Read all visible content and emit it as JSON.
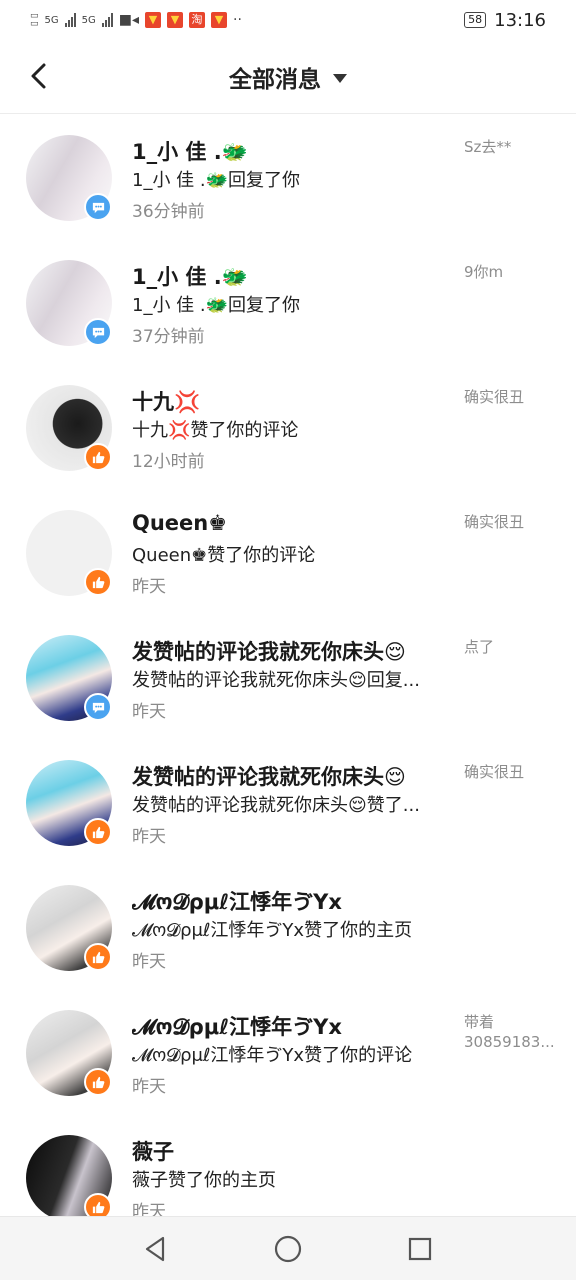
{
  "status_bar": {
    "left_icons": [
      "sim-icon",
      "signal-5g-icon",
      "signal-5g-icon",
      "video-icon",
      "notification-icon",
      "notification-icon",
      "taobao-icon",
      "notification-icon",
      "more-dots-icon"
    ],
    "net1": "5G",
    "net2": "5G",
    "taobao": "淘",
    "battery": "58",
    "time": "13:16"
  },
  "header": {
    "title": "全部消息",
    "back_icon": "back-arrow-icon",
    "dropdown_icon": "caret-down-icon"
  },
  "messages": [
    {
      "name": "1_小 佳 .🐲",
      "desc": "1_小 佳 .🐲回复了你",
      "time": "36分钟前",
      "ref": "Sz去**",
      "type": "comment"
    },
    {
      "name": "1_小 佳 .🐲",
      "desc": "1_小 佳 .🐲回复了你",
      "time": "37分钟前",
      "ref": "9你m",
      "type": "comment"
    },
    {
      "name": "十九💢",
      "desc": "十九💢赞了你的评论",
      "time": "12小时前",
      "ref": "确实很丑",
      "type": "like"
    },
    {
      "name": "Queen♚",
      "desc": "Queen♚赞了你的评论",
      "time": "昨天",
      "ref": "确实很丑",
      "type": "like"
    },
    {
      "name": "发赞帖的评论我就死你床头😌",
      "desc": "发赞帖的评论我就死你床头😌回复...",
      "time": "昨天",
      "ref": "点了",
      "type": "comment"
    },
    {
      "name": "发赞帖的评论我就死你床头😌",
      "desc": "发赞帖的评论我就死你床头😌赞了...",
      "time": "昨天",
      "ref": "确实很丑",
      "type": "like"
    },
    {
      "name": "𝓜ო𝓓ρμℓ江悸年ゔYx",
      "desc": "𝓜ო𝓓ρμℓ江悸年ゔYx赞了你的主页",
      "time": "昨天",
      "ref": "",
      "type": "like"
    },
    {
      "name": "𝓜ო𝓓ρμℓ江悸年ゔYx",
      "desc": "𝓜ო𝓓ρμℓ江悸年ゔYx赞了你的评论",
      "time": "昨天",
      "ref": "带着\n30859183...",
      "type": "like"
    },
    {
      "name": "薇子",
      "desc": "薇子赞了你的主页",
      "time": "昨天",
      "ref": "",
      "type": "like"
    }
  ],
  "colors": {
    "like_badge": "#ff7a1a",
    "comment_badge": "#4aa3f0",
    "time_text": "#8a8a8a"
  },
  "navbar": {
    "icons": [
      "back-triangle-icon",
      "home-circle-icon",
      "recents-square-icon"
    ]
  }
}
